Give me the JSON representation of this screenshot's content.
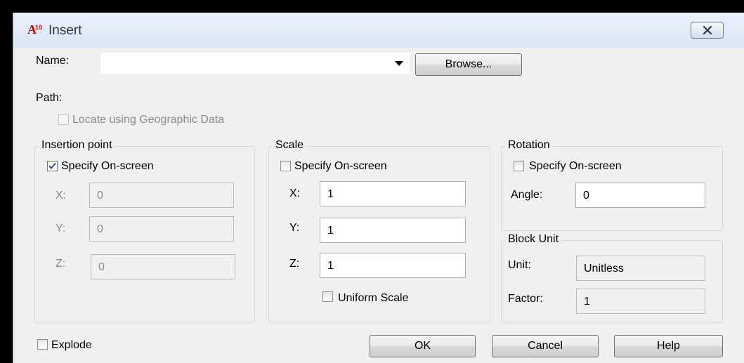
{
  "window": {
    "title": "Insert",
    "icon": "autocad-app-icon"
  },
  "name_row": {
    "label": "Name:",
    "value": "",
    "browse_label": "Browse..."
  },
  "path": {
    "label": "Path:"
  },
  "geo_checkbox": {
    "label": "Locate using Geographic Data",
    "checked": false,
    "enabled": false
  },
  "insertion_point": {
    "title": "Insertion point",
    "specify_label": "Specify On-screen",
    "specify_checked": true,
    "x_label": "X:",
    "x_value": "0",
    "y_label": "Y:",
    "y_value": "0",
    "z_label": "Z:",
    "z_value": "0"
  },
  "scale": {
    "title": "Scale",
    "specify_label": "Specify On-screen",
    "specify_checked": false,
    "x_label": "X:",
    "x_value": "1",
    "y_label": "Y:",
    "y_value": "1",
    "z_label": "Z:",
    "z_value": "1",
    "uniform_label": "Uniform Scale",
    "uniform_checked": false
  },
  "rotation": {
    "title": "Rotation",
    "specify_label": "Specify On-screen",
    "specify_checked": false,
    "angle_label": "Angle:",
    "angle_value": "0"
  },
  "block_unit": {
    "title": "Block Unit",
    "unit_label": "Unit:",
    "unit_value": "Unitless",
    "factor_label": "Factor:",
    "factor_value": "1"
  },
  "explode": {
    "label": "Explode",
    "checked": false
  },
  "buttons": {
    "ok": "OK",
    "cancel": "Cancel",
    "help": "Help"
  }
}
